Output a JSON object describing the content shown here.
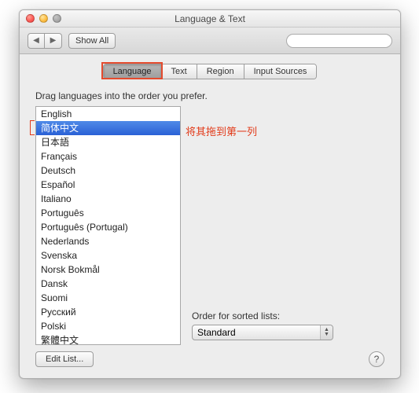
{
  "window": {
    "title": "Language & Text"
  },
  "toolbar": {
    "show_all": "Show All",
    "search_placeholder": ""
  },
  "tabs": {
    "items": [
      {
        "label": "Language",
        "active": true
      },
      {
        "label": "Text",
        "active": false
      },
      {
        "label": "Region",
        "active": false
      },
      {
        "label": "Input Sources",
        "active": false
      }
    ]
  },
  "instruction": "Drag languages into the order you prefer.",
  "languages": [
    "English",
    "简体中文",
    "日本語",
    "Français",
    "Deutsch",
    "Español",
    "Italiano",
    "Português",
    "Português (Portugal)",
    "Nederlands",
    "Svenska",
    "Norsk Bokmål",
    "Dansk",
    "Suomi",
    "Русский",
    "Polski",
    "繁體中文"
  ],
  "selected_index": 1,
  "annotation": "将其拖到第一列",
  "order": {
    "label": "Order for sorted lists:",
    "value": "Standard"
  },
  "edit_list": "Edit List...",
  "help": "?"
}
